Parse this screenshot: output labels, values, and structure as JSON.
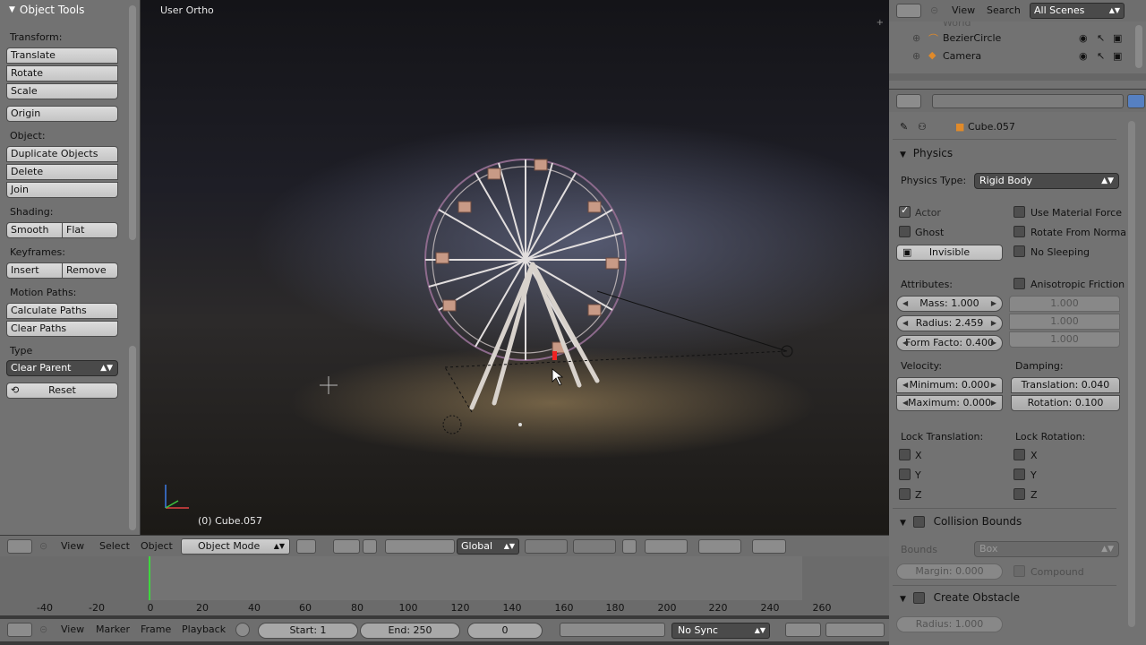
{
  "toolshelf": {
    "title": "Object Tools",
    "transform_label": "Transform:",
    "translate": "Translate",
    "rotate": "Rotate",
    "scale": "Scale",
    "origin": "Origin",
    "object_label": "Object:",
    "duplicate": "Duplicate Objects",
    "delete": "Delete",
    "join": "Join",
    "shading_label": "Shading:",
    "smooth": "Smooth",
    "flat": "Flat",
    "keyframes_label": "Keyframes:",
    "insert": "Insert",
    "remove": "Remove",
    "motion_paths_label": "Motion Paths:",
    "calculate_paths": "Calculate Paths",
    "clear_paths": "Clear Paths",
    "type_label": "Type",
    "type_value": "Clear Parent",
    "reset": "Reset"
  },
  "viewport": {
    "view_name": "User Ortho",
    "object_status": "(0) Cube.057"
  },
  "view3d_header": {
    "view": "View",
    "select": "Select",
    "object": "Object",
    "mode": "Object Mode",
    "orientation": "Global"
  },
  "timeline": {
    "ruler": [
      "-40",
      "-20",
      "0",
      "20",
      "40",
      "60",
      "80",
      "100",
      "120",
      "140",
      "160",
      "180",
      "200",
      "220",
      "240",
      "260"
    ],
    "current_frame_marker": 0
  },
  "timeline_footer": {
    "view": "View",
    "marker": "Marker",
    "frame": "Frame",
    "playback": "Playback",
    "start": "Start: 1",
    "end": "End: 250",
    "current": "0",
    "sync": "No Sync"
  },
  "outliner": {
    "view": "View",
    "search": "Search",
    "scenes": "All Scenes",
    "rows": [
      {
        "name": "World"
      },
      {
        "name": "BezierCircle"
      },
      {
        "name": "Camera"
      }
    ]
  },
  "properties": {
    "object_name": "Cube.057",
    "physics": {
      "title": "Physics",
      "type_label": "Physics Type:",
      "type_value": "Rigid Body",
      "actor": "Actor",
      "ghost": "Ghost",
      "invisible": "Invisible",
      "use_material_force": "Use Material Force",
      "rotate_from_normal": "Rotate From Norma",
      "no_sleeping": "No Sleeping",
      "attributes_label": "Attributes:",
      "anisotropic_friction": "Anisotropic Friction",
      "mass": "Mass: 1.000",
      "radius": "Radius: 2.459",
      "form_factor": "Form Facto: 0.400",
      "aniso_x": "1.000",
      "aniso_y": "1.000",
      "aniso_z": "1.000",
      "velocity_label": "Velocity:",
      "vel_min": "Minimum: 0.000",
      "vel_max": "Maximum: 0.000",
      "damping_label": "Damping:",
      "translation": "Translation: 0.040",
      "rotation": "Rotation: 0.100",
      "lock_translation_label": "Lock Translation:",
      "lock_rotation_label": "Lock Rotation:",
      "x": "X",
      "y": "Y",
      "z": "Z"
    },
    "collision": {
      "title": "Collision Bounds",
      "bounds_label": "Bounds",
      "bounds_value": "Box",
      "margin": "Margin: 0.000",
      "compound": "Compound"
    },
    "obstacle": {
      "title": "Create Obstacle",
      "radius": "Radius: 1.000"
    }
  },
  "colors": {
    "panel_bg": "#727272",
    "header_bg": "#6e6e6e",
    "frame_marker": "#3fd63f",
    "accent_blue": "#5680c2"
  }
}
